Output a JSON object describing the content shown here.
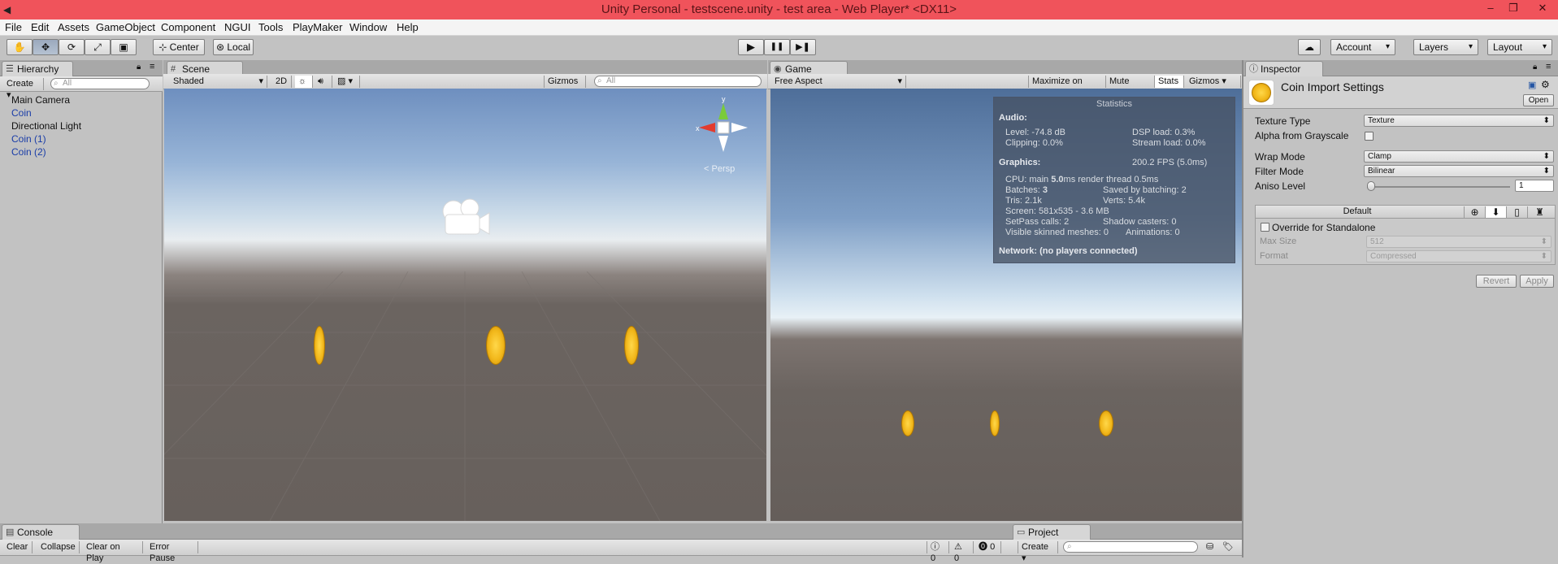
{
  "window": {
    "title": "Unity Personal - testscene.unity - test area - Web Player* <DX11>",
    "app_icon": "unity-logo-icon",
    "controls": [
      "–",
      "❐",
      "✕"
    ]
  },
  "menu": [
    "File",
    "Edit",
    "Assets",
    "GameObject",
    "Component",
    "NGUI",
    "Tools",
    "PlayMaker",
    "Window",
    "Help"
  ],
  "toolbar": {
    "tools": [
      {
        "icon": "hand-icon",
        "glyph": "✋"
      },
      {
        "icon": "move-icon",
        "glyph": "✥"
      },
      {
        "icon": "rotate-icon",
        "glyph": "⟳"
      },
      {
        "icon": "scale-icon",
        "glyph": "⤢"
      },
      {
        "icon": "rect-icon",
        "glyph": "▣"
      }
    ],
    "pivot": "Center",
    "space": "Local",
    "play": "▶",
    "pause": "❚❚",
    "step": "▶❚",
    "account": "Account",
    "layers": "Layers",
    "layout": "Layout"
  },
  "hierarchy": {
    "tab": "Hierarchy",
    "create": "Create",
    "search_placeholder": "All",
    "items": [
      {
        "label": "Main Camera",
        "prefab": false
      },
      {
        "label": "Coin",
        "prefab": true
      },
      {
        "label": "Directional Light",
        "prefab": false
      },
      {
        "label": "Coin (1)",
        "prefab": true
      },
      {
        "label": "Coin (2)",
        "prefab": true
      }
    ]
  },
  "scene": {
    "tab": "Scene",
    "shading": "Shaded",
    "mode_2d": "2D",
    "gizmos": "Gizmos",
    "search_placeholder": "All",
    "persp": "Persp",
    "gizmo_axes": {
      "x": "x",
      "y": "y"
    }
  },
  "game": {
    "tab": "Game",
    "aspect": "Free Aspect",
    "maximize": "Maximize on Play",
    "mute": "Mute audio",
    "stats": "Stats",
    "gizmos": "Gizmos"
  },
  "statistics": {
    "title": "Statistics",
    "audio_header": "Audio:",
    "level": "Level: -74.8 dB",
    "dsp_load": "DSP load: 0.3%",
    "clipping": "Clipping: 0.0%",
    "stream_load": "Stream load: 0.0%",
    "graphics_header": "Graphics:",
    "fps": "200.2 FPS (5.0ms)",
    "cpu_prefix": "CPU: main ",
    "cpu_main": "5.0",
    "cpu_suffix": "ms  render thread 0.5ms",
    "batches_prefix": "Batches: ",
    "batches": "3",
    "saved_batching": "Saved by batching: 2",
    "tris": "Tris: 2.1k",
    "verts": "Verts: 5.4k",
    "screen": "Screen: 581x535 - 3.6 MB",
    "setpass": "SetPass calls: 2",
    "shadow_casters": "Shadow casters: 0",
    "skinned": "Visible skinned meshes: 0",
    "animations": "Animations: 0",
    "network": "Network: (no players connected)"
  },
  "inspector": {
    "tab": "Inspector",
    "asset_title": "Coin Import Settings",
    "open_button": "Open",
    "texture_type_label": "Texture Type",
    "texture_type": "Texture",
    "alpha_label": "Alpha from Grayscale",
    "wrap_label": "Wrap Mode",
    "wrap": "Clamp",
    "filter_label": "Filter Mode",
    "filter": "Bilinear",
    "aniso_label": "Aniso Level",
    "aniso": "1",
    "aniso_fraction": 0.0,
    "platform_default": "Default",
    "override_label": "Override for Standalone",
    "max_size_label": "Max Size",
    "max_size": "512",
    "format_label": "Format",
    "format": "Compressed",
    "revert": "Revert",
    "apply": "Apply"
  },
  "console": {
    "tab": "Console",
    "buttons": [
      "Clear",
      "Collapse",
      "Clear on Play",
      "Error Pause"
    ],
    "info_count": "0",
    "warn_count": "0",
    "error_count": "0"
  },
  "project": {
    "tab": "Project",
    "create": "Create"
  }
}
